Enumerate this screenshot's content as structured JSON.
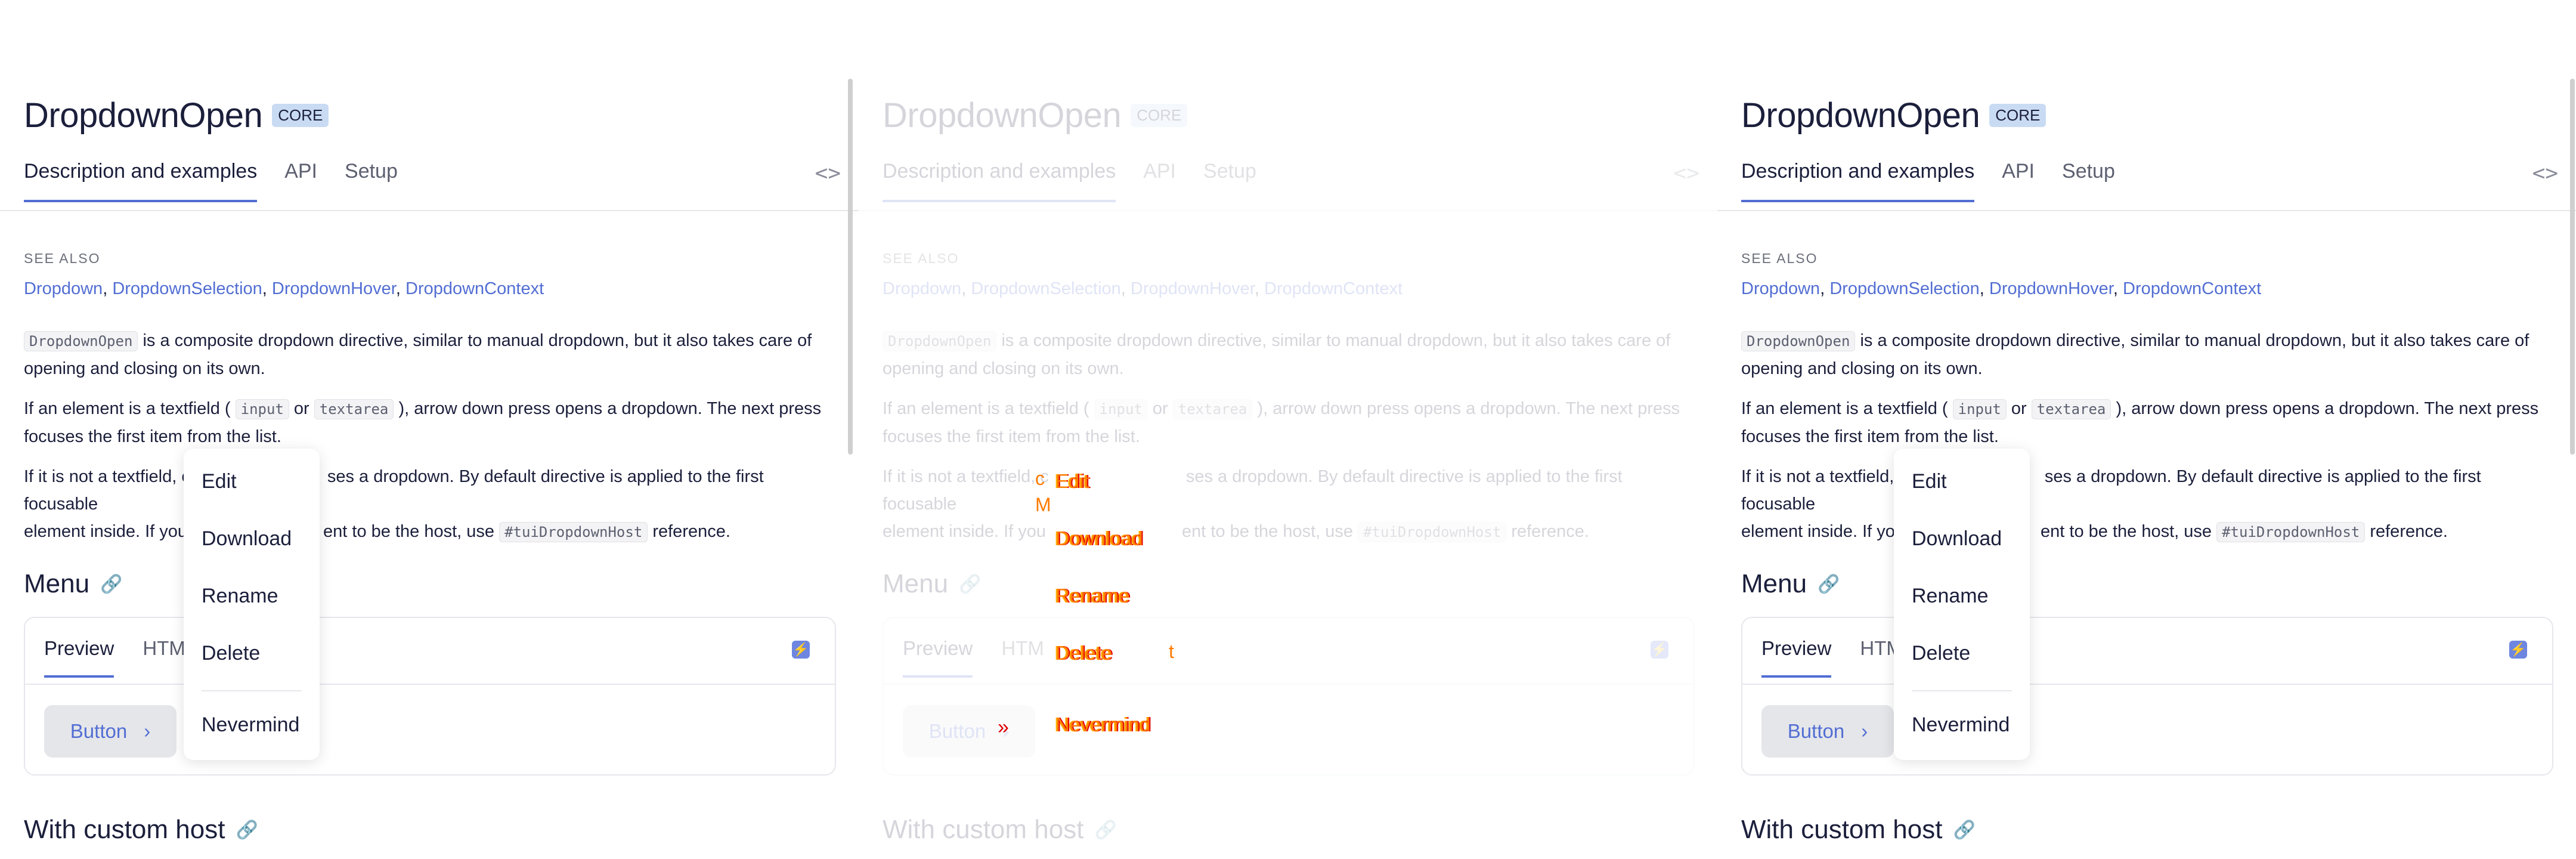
{
  "page": {
    "title": "DropdownOpen",
    "badge": "CORE",
    "tabs": [
      "Description and examples",
      "API",
      "Setup"
    ],
    "code_toggle": "<>",
    "see_also_label": "SEE ALSO",
    "see_also_links": [
      "Dropdown",
      "DropdownSelection",
      "DropdownHover",
      "DropdownContext"
    ],
    "see_also_sep": ",",
    "para1": {
      "code": "DropdownOpen",
      "text_a": " is a composite dropdown directive, similar to manual dropdown, but it also takes care of",
      "text_b": "opening and closing on its own."
    },
    "para2": {
      "text_a": "If an element is a textfield (",
      "code1": "input",
      "or": " or ",
      "code2": "textarea",
      "text_b": "), arrow down press opens a dropdown. The next press",
      "text_c": "focuses the first item from the list."
    },
    "para3": {
      "text_a": "If it is not a textfield, c",
      "text_b": "ses a dropdown. By default directive is applied to the first focusable",
      "text_c": "element inside. If you",
      "text_d": "ent to be the host, use",
      "code": "#tuiDropdownHost",
      "text_e": "reference."
    },
    "menu_section": "Menu",
    "custom_host_section": "With custom host",
    "demo": {
      "tabs": [
        "Preview",
        "HTM"
      ],
      "tab_tail": "t",
      "button_label": "Button",
      "button_chevron": "›",
      "bolt": "⚡"
    },
    "dropdown": {
      "items": [
        "Edit",
        "Download",
        "Rename",
        "Delete",
        "Nevermind"
      ]
    },
    "ghost": {
      "chevron": "»",
      "frag1": "c",
      "frag2": "M"
    },
    "colors": {
      "accent": "#526ed3",
      "badge_bg": "#c9dbf3",
      "text": "#1b1f3b",
      "ghost_orange": "#ff7a00",
      "ghost_red": "#e00000"
    }
  }
}
